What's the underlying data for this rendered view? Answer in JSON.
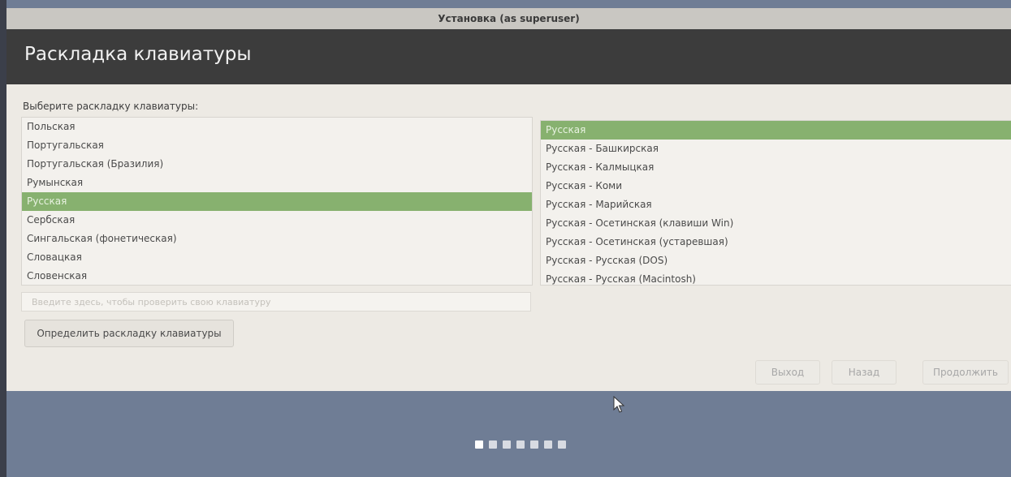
{
  "window": {
    "title": "Установка (as superuser)"
  },
  "header": {
    "title": "Раскладка клавиатуры"
  },
  "layout_prompt": "Выберите раскладку клавиатуры:",
  "layouts": [
    "Польская",
    "Португальская",
    "Португальская (Бразилия)",
    "Румынская",
    "Русская",
    "Сербская",
    "Сингальская (фонетическая)",
    "Словацкая",
    "Словенская"
  ],
  "selected_layout": "Русская",
  "variants": [
    "Русская",
    "Русская - Башкирская",
    "Русская - Калмыцкая",
    "Русская - Коми",
    "Русская - Марийская",
    "Русская - Осетинская (клавиши Win)",
    "Русская - Осетинская (устаревшая)",
    "Русская - Русская (DOS)",
    "Русская - Русская (Macintosh)"
  ],
  "selected_variant": "Русская",
  "test_input": {
    "placeholder": "Введите здесь, чтобы проверить свою клавиатуру"
  },
  "detect_button": "Определить раскладку клавиатуры",
  "nav": {
    "quit": "Выход",
    "back": "Назад",
    "continue": "Продолжить"
  },
  "progress": {
    "total_steps": 7,
    "current_step": 0
  },
  "colors": {
    "selection": "#87b16f",
    "header_bg": "#3c3c3c",
    "content_bg": "#edeae4",
    "footer_bg": "#6f7d95"
  }
}
